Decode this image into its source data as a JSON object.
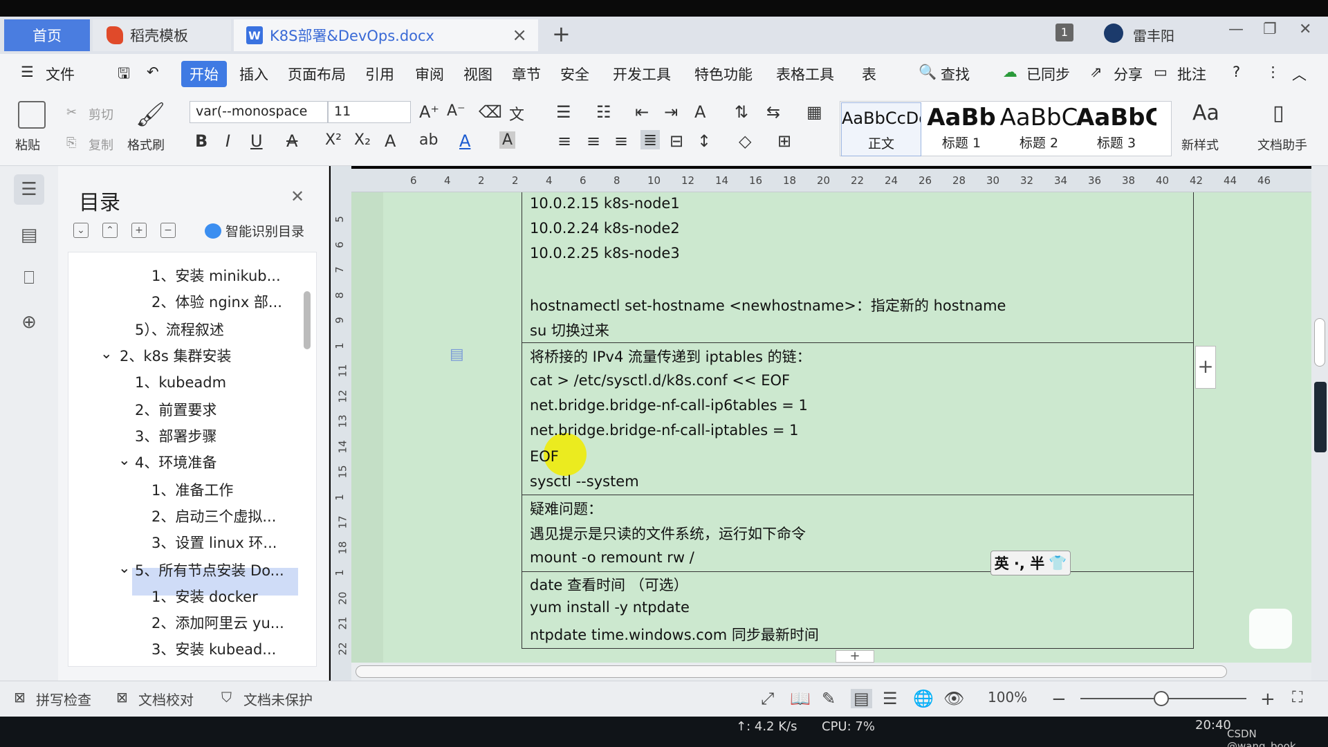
{
  "tabs": {
    "home": "首页",
    "template": "稻壳模板",
    "doc": "K8S部署&DevOps.docx",
    "user": "雷丰阳",
    "badge": "1"
  },
  "menu": {
    "file": "文件",
    "start": "开始",
    "insert": "插入",
    "layout": "页面布局",
    "ref": "引用",
    "review": "审阅",
    "view": "视图",
    "chapter": "章节",
    "security": "安全",
    "dev": "开发工具",
    "special": "特色功能",
    "table": "表格工具",
    "more": "表",
    "find": "查找",
    "synced": "已同步",
    "share": "分享",
    "comment": "批注"
  },
  "toolbar": {
    "paste": "粘贴",
    "cut": "剪切",
    "copy": "复制",
    "format_painter": "格式刷",
    "font": "var(--monospace",
    "size": "11",
    "new_style": "新样式",
    "doc_helper": "文档助手"
  },
  "styles": [
    {
      "preview": "AaBbCcDd",
      "label": "正文"
    },
    {
      "preview": "AaBb",
      "label": "标题 1"
    },
    {
      "preview": "AaBbC",
      "label": "标题 2"
    },
    {
      "preview": "AaBbC",
      "label": "标题 3"
    }
  ],
  "toc": {
    "title": "目录",
    "smart": "智能识别目录",
    "items": [
      "1、安装 minikub...",
      "2、体验 nginx 部...",
      "5）、流程叙述",
      "2、k8s 集群安装",
      "1、kubeadm",
      "2、前置要求",
      "3、部署步骤",
      "4、环境准备",
      "1、准备工作",
      "2、启动三个虚拟...",
      "3、设置 linux 环...",
      "5、所有节点安装 Do...",
      "1、安装 docker",
      "2、添加阿里云 yu...",
      "3、安装 kubead..."
    ]
  },
  "ruler": {
    "h": [
      "6",
      "4",
      "2",
      "2",
      "4",
      "6",
      "8",
      "10",
      "12",
      "14",
      "16",
      "18",
      "20",
      "22",
      "24",
      "26",
      "28",
      "30",
      "32",
      "34",
      "36",
      "38",
      "40",
      "42",
      "44",
      "46"
    ],
    "v": [
      "5",
      "6",
      "7",
      "8",
      "9",
      "1",
      "11",
      "12",
      "13",
      "14",
      "15",
      "1",
      "17",
      "18",
      "1",
      "20",
      "21",
      "22"
    ]
  },
  "doc": {
    "lines": [
      "10.0.2.15 k8s-node1",
      "10.0.2.24 k8s-node2",
      "10.0.2.25 k8s-node3",
      "hostnamectl set-hostname <newhostname>：指定新的 hostname",
      "su  切换过来",
      "将桥接的 IPv4 流量传递到 iptables 的链：",
      "cat > /etc/sysctl.d/k8s.conf << EOF",
      "net.bridge.bridge-nf-call-ip6tables = 1",
      "net.bridge.bridge-nf-call-iptables = 1",
      "EOF",
      "sysctl --system",
      "疑难问题：",
      "遇见提示是只读的文件系统，运行如下命令",
      "mount -o remount rw /",
      "date   查看时间  （可选）",
      "yum install -y ntpdate",
      "ntpdate time.windows.com    同步最新时间"
    ],
    "ime": "英 ·, 半"
  },
  "status": {
    "spell": "拼写检查",
    "proof": "文档校对",
    "protect": "文档未保护",
    "zoom": "100%"
  },
  "taskbar": {
    "net": "↑: 4.2 K/s",
    "cpu": "CPU: 7%",
    "time": "20:40",
    "watermark": "CSDN @wang_book"
  }
}
